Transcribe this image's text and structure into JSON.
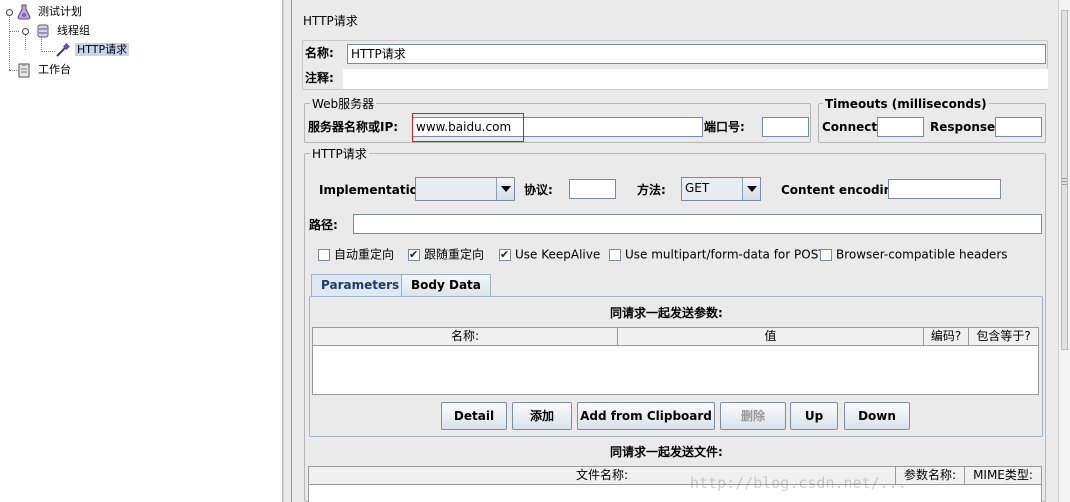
{
  "tree": {
    "items": [
      {
        "label": "测试计划",
        "icon": "flask-icon"
      },
      {
        "label": "线程组",
        "icon": "spool-icon"
      },
      {
        "label": "HTTP请求",
        "icon": "pipette-icon"
      },
      {
        "label": "工作台",
        "icon": "clipboard-icon"
      }
    ]
  },
  "panel": {
    "title": "HTTP请求",
    "name_label": "名称:",
    "name_value": "HTTP请求",
    "comment_label": "注释:",
    "comment_value": ""
  },
  "web_server": {
    "legend": "Web服务器",
    "server_label": "服务器名称或IP:",
    "server_value": "www.baidu.com",
    "port_label": "端口号:",
    "port_value": ""
  },
  "timeouts": {
    "legend": "Timeouts (milliseconds)",
    "connect_label": "Connect:",
    "connect_value": "",
    "response_label": "Response:",
    "response_value": ""
  },
  "http_request": {
    "legend": "HTTP请求",
    "implementation_label": "Implementation:",
    "implementation_value": "",
    "protocol_label": "协议:",
    "protocol_value": "",
    "method_label": "方法:",
    "method_value": "GET",
    "encoding_label": "Content encoding:",
    "encoding_value": "",
    "path_label": "路径:",
    "path_value": ""
  },
  "options": [
    {
      "label": "自动重定向",
      "checked": false
    },
    {
      "label": "跟随重定向",
      "checked": true
    },
    {
      "label": "Use KeepAlive",
      "checked": true
    },
    {
      "label": "Use multipart/form-data for POST",
      "checked": false
    },
    {
      "label": "Browser-compatible headers",
      "checked": false
    }
  ],
  "tabs": [
    {
      "label": "Parameters",
      "active": true
    },
    {
      "label": "Body Data",
      "active": false
    }
  ],
  "params": {
    "caption": "同请求一起发送参数:",
    "columns": [
      "名称:",
      "值",
      "编码?",
      "包含等于?"
    ]
  },
  "buttons": {
    "detail": "Detail",
    "add": "添加",
    "clipboard": "Add from Clipboard",
    "delete": "删除",
    "up": "Up",
    "down": "Down"
  },
  "files": {
    "caption": "同请求一起发送文件:",
    "columns": [
      "文件名称:",
      "参数名称:",
      "MIME类型:"
    ]
  },
  "watermark": "http://blog.csdn.net/..."
}
